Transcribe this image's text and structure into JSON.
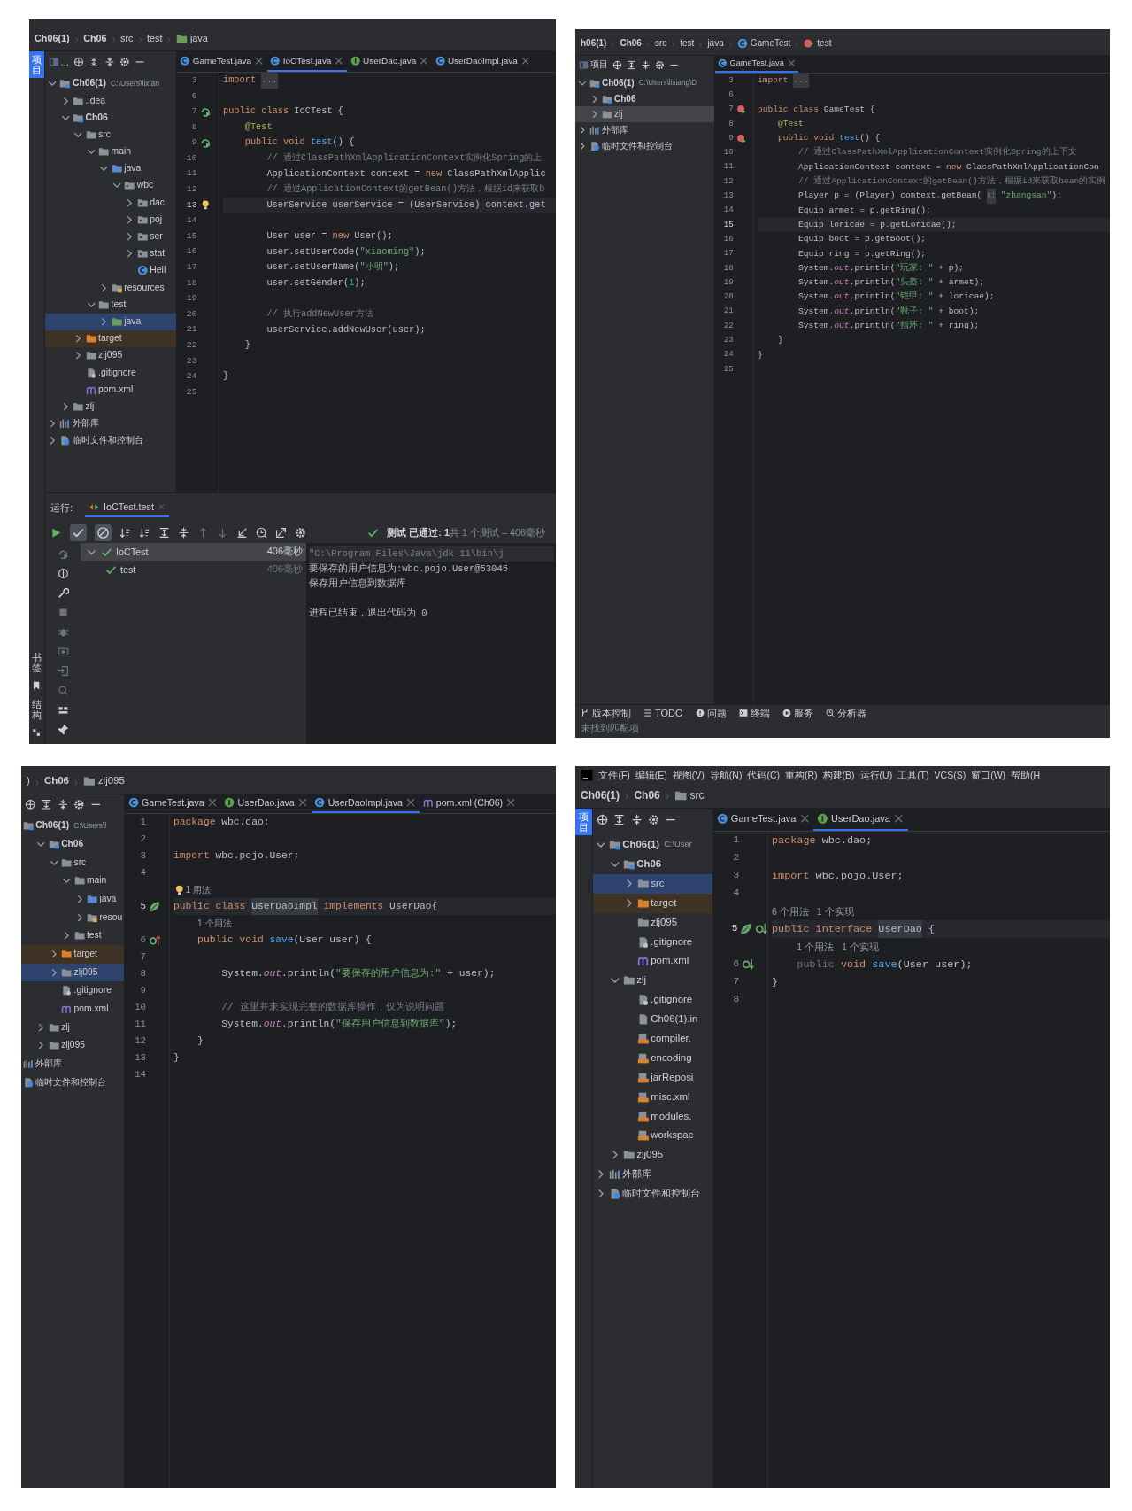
{
  "panels": [
    {
      "breadcrumb": [
        {
          "label": "Ch06(1)",
          "kind": "module"
        },
        {
          "label": "Ch06",
          "kind": "module"
        },
        {
          "label": "src",
          "kind": "plain"
        },
        {
          "label": "test",
          "kind": "plain"
        },
        {
          "label": "java",
          "kind": "test-root"
        }
      ],
      "strip": {
        "top": [
          {
            "label": "项目",
            "selected": true
          }
        ],
        "bottom": [
          {
            "label": "书签",
            "kind": "bookmarks"
          },
          {
            "label": "结构",
            "kind": "structure"
          }
        ]
      },
      "project_pane": {
        "title": "...",
        "focused": true,
        "tree": [
          {
            "label": "Ch06(1)",
            "kind": "module",
            "hint": "C:\\Users\\lixian",
            "expanded": true,
            "selected": false,
            "children": [
              {
                "label": ".idea",
                "kind": "folder",
                "expanded": false,
                "selected": false
              },
              {
                "label": "Ch06",
                "kind": "module",
                "expanded": true,
                "selected": false,
                "children": [
                  {
                    "label": "src",
                    "kind": "folder",
                    "expanded": true,
                    "selected": false,
                    "children": [
                      {
                        "label": "main",
                        "kind": "folder",
                        "expanded": true,
                        "selected": false,
                        "children": [
                          {
                            "label": "java",
                            "kind": "source-root",
                            "expanded": true,
                            "selected": false,
                            "children": [
                              {
                                "label": "wbc",
                                "kind": "package",
                                "expanded": true,
                                "selected": false,
                                "children": [
                                  {
                                    "label": "dac",
                                    "kind": "package",
                                    "expanded": false,
                                    "selected": false
                                  },
                                  {
                                    "label": "poj",
                                    "kind": "package",
                                    "expanded": false,
                                    "selected": false
                                  },
                                  {
                                    "label": "ser",
                                    "kind": "package",
                                    "expanded": false,
                                    "selected": false
                                  },
                                  {
                                    "label": "stat",
                                    "kind": "package",
                                    "expanded": false,
                                    "selected": false
                                  },
                                  {
                                    "label": "Hell",
                                    "kind": "class",
                                    "selected": false
                                  }
                                ]
                              }
                            ]
                          },
                          {
                            "label": "resources",
                            "kind": "resources",
                            "expanded": false,
                            "selected": false
                          }
                        ]
                      },
                      {
                        "label": "test",
                        "kind": "folder",
                        "expanded": true,
                        "selected": false,
                        "children": [
                          {
                            "label": "java",
                            "kind": "test-root",
                            "expanded": false,
                            "selected": true
                          }
                        ]
                      }
                    ]
                  },
                  {
                    "label": "target",
                    "kind": "excluded",
                    "expanded": false,
                    "selected": false
                  },
                  {
                    "label": "zlj095",
                    "kind": "folder",
                    "expanded": false,
                    "selected": false
                  },
                  {
                    "label": ".gitignore",
                    "kind": "git",
                    "selected": false
                  },
                  {
                    "label": "pom.xml",
                    "kind": "maven",
                    "selected": false
                  }
                ]
              },
              {
                "label": "zlj",
                "kind": "folder",
                "expanded": false,
                "selected": false
              }
            ]
          },
          {
            "label": "外部库",
            "kind": "library",
            "expanded": false,
            "selected": false
          },
          {
            "label": "临时文件和控制台",
            "kind": "scratch",
            "expanded": false,
            "selected": false
          }
        ]
      },
      "tabs": [
        {
          "label": "GameTest.java",
          "kind": "class",
          "selected": false
        },
        {
          "label": "IoCTest.java",
          "kind": "class",
          "selected": true
        },
        {
          "label": "UserDao.java",
          "kind": "interface",
          "selected": false
        },
        {
          "label": "UserDaoImpl.java",
          "kind": "class",
          "selected": false
        }
      ],
      "editor": {
        "lines": [
          {
            "kind": "code",
            "num": "3",
            "current": false,
            "tokens": [
              {
                "text": "import ",
                "kind": "kw"
              },
              {
                "text": "...",
                "kind": "fold"
              }
            ]
          },
          {
            "kind": "code",
            "num": "6",
            "current": false
          },
          {
            "kind": "code",
            "num": "7",
            "current": false,
            "markers": [
              {
                "kind": "run-ok"
              }
            ],
            "tokens": [
              {
                "text": "public class ",
                "kind": "kw"
              },
              {
                "text": "IoCTest {"
              }
            ]
          },
          {
            "kind": "code",
            "num": "8",
            "current": false,
            "tokens": [
              {
                "text": "    @Test",
                "kind": "ann"
              }
            ]
          },
          {
            "kind": "code",
            "num": "9",
            "current": false,
            "markers": [
              {
                "kind": "run-ok"
              }
            ],
            "tokens": [
              {
                "text": "    public void ",
                "kind": "kw"
              },
              {
                "text": "test",
                "kind": "fn"
              },
              {
                "text": "() {"
              }
            ]
          },
          {
            "kind": "code",
            "num": "10",
            "current": false,
            "tokens": [
              {
                "text": "        // 通过ClassPathXmlApplicationContext实例化Spring的上",
                "kind": "cmt"
              }
            ]
          },
          {
            "kind": "code",
            "num": "11",
            "current": false,
            "tokens": [
              {
                "text": "        ApplicationContext context = "
              },
              {
                "text": "new ",
                "kind": "kw"
              },
              {
                "text": "ClassPathXmlApplic"
              }
            ]
          },
          {
            "kind": "code",
            "num": "12",
            "current": false,
            "tokens": [
              {
                "text": "        // 通过ApplicationContext的getBean()方法，根据id来获取b",
                "kind": "cmt"
              }
            ]
          },
          {
            "kind": "code",
            "num": "13",
            "current": true,
            "markers": [
              {
                "kind": "bulb"
              }
            ],
            "tokens": [
              {
                "text": "        UserService userService = (UserService) context.get"
              }
            ]
          },
          {
            "kind": "code",
            "num": "14",
            "current": false
          },
          {
            "kind": "code",
            "num": "15",
            "current": false,
            "tokens": [
              {
                "text": "        User user = "
              },
              {
                "text": "new ",
                "kind": "kw"
              },
              {
                "text": "User();"
              }
            ]
          },
          {
            "kind": "code",
            "num": "16",
            "current": false,
            "tokens": [
              {
                "text": "        user.setUserCode("
              },
              {
                "text": "\"xiaoming\"",
                "kind": "str"
              },
              {
                "text": ");"
              }
            ]
          },
          {
            "kind": "code",
            "num": "17",
            "current": false,
            "tokens": [
              {
                "text": "        user.setUserName("
              },
              {
                "text": "\"小明\"",
                "kind": "str"
              },
              {
                "text": ");"
              }
            ]
          },
          {
            "kind": "code",
            "num": "18",
            "current": false,
            "tokens": [
              {
                "text": "        user.setGender("
              },
              {
                "text": "1",
                "kind": "num"
              },
              {
                "text": ");"
              }
            ]
          },
          {
            "kind": "code",
            "num": "19",
            "current": false
          },
          {
            "kind": "code",
            "num": "20",
            "current": false,
            "tokens": [
              {
                "text": "        // 执行addNewUser方法",
                "kind": "cmt"
              }
            ]
          },
          {
            "kind": "code",
            "num": "21",
            "current": false,
            "tokens": [
              {
                "text": "        userService.addNewUser(user);"
              }
            ]
          },
          {
            "kind": "code",
            "num": "22",
            "current": false,
            "tokens": [
              {
                "text": "    }"
              }
            ]
          },
          {
            "kind": "code",
            "num": "23",
            "current": false
          },
          {
            "kind": "code",
            "num": "24",
            "current": false,
            "tokens": [
              {
                "text": "}"
              }
            ]
          },
          {
            "kind": "code",
            "num": "25",
            "current": false
          }
        ]
      },
      "run_panel": {
        "label": "运行:",
        "tabs": [
          {
            "label": "IoCTest.test",
            "selected": true
          }
        ],
        "toggles": [
          {
            "kind": "passed",
            "on": true
          },
          {
            "kind": "ignored",
            "on": true
          }
        ],
        "status": "**测试 已通过: 1**共 1 个测试 – 406毫秒",
        "tests": [
          {
            "name": "IoCTest",
            "time": "406毫秒",
            "passed": true,
            "expanded": true,
            "selected": true,
            "children": [
              {
                "name": "test",
                "time": "406毫秒",
                "passed": true,
                "selected": false
              }
            ]
          }
        ],
        "console": [
          {
            "kind": "command",
            "text": "\"C:\\Program Files\\Java\\jdk-11\\bin\\j"
          },
          {
            "kind": "output",
            "text": "要保存的用户信息为:wbc.pojo.User@53045"
          },
          {
            "kind": "output",
            "text": "保存用户信息到数据库"
          },
          {
            "kind": "exit",
            "text": "进程已结束，退出代码为 0"
          }
        ]
      }
    },
    {
      "breadcrumb": [
        {
          "label": "h06(1)",
          "kind": "module"
        },
        {
          "label": "Ch06",
          "kind": "module"
        },
        {
          "label": "src",
          "kind": "plain"
        },
        {
          "label": "test",
          "kind": "plain"
        },
        {
          "label": "java",
          "kind": "plain"
        },
        {
          "label": "GameTest",
          "kind": "class"
        },
        {
          "label": "test",
          "kind": "method"
        }
      ],
      "project_pane": {
        "title": "项目",
        "focused": false,
        "tree": [
          {
            "label": "Ch06(1)",
            "kind": "module",
            "hint": "C:\\Users\\lixiang\\D",
            "expanded": true,
            "selected": false,
            "children": [
              {
                "label": "Ch06",
                "kind": "module",
                "expanded": false,
                "selected": false
              },
              {
                "label": "zlj",
                "kind": "folder",
                "expanded": false,
                "selected": true
              }
            ]
          },
          {
            "label": "外部库",
            "kind": "library",
            "expanded": false,
            "selected": false
          },
          {
            "label": "临时文件和控制台",
            "kind": "scratch",
            "expanded": false,
            "selected": false
          }
        ]
      },
      "tabs": [
        {
          "label": "GameTest.java",
          "kind": "class",
          "selected": true
        }
      ],
      "editor": {
        "lines": [
          {
            "kind": "code",
            "num": "3",
            "current": false,
            "tokens": [
              {
                "text": "import ",
                "kind": "kw"
              },
              {
                "text": "...",
                "kind": "fold"
              }
            ]
          },
          {
            "kind": "code",
            "num": "6",
            "current": false
          },
          {
            "kind": "code",
            "num": "7",
            "current": false,
            "markers": [
              {
                "kind": "run-fail"
              }
            ],
            "tokens": [
              {
                "text": "public class ",
                "kind": "kw"
              },
              {
                "text": "GameTest {"
              }
            ]
          },
          {
            "kind": "code",
            "num": "8",
            "current": false,
            "tokens": [
              {
                "text": "    @Test",
                "kind": "ann"
              }
            ]
          },
          {
            "kind": "code",
            "num": "9",
            "current": false,
            "markers": [
              {
                "kind": "run-fail"
              }
            ],
            "tokens": [
              {
                "text": "    public void ",
                "kind": "kw"
              },
              {
                "text": "test",
                "kind": "fn"
              },
              {
                "text": "() {"
              }
            ]
          },
          {
            "kind": "code",
            "num": "10",
            "current": false,
            "tokens": [
              {
                "text": "        // 通过ClassPathXmlApplicationContext实例化Spring的上下文",
                "kind": "cmt"
              }
            ]
          },
          {
            "kind": "code",
            "num": "11",
            "current": false,
            "tokens": [
              {
                "text": "        ApplicationContext context = "
              },
              {
                "text": "new ",
                "kind": "kw"
              },
              {
                "text": "ClassPathXmlApplicationCon"
              }
            ]
          },
          {
            "kind": "code",
            "num": "12",
            "current": false,
            "tokens": [
              {
                "text": "        // 通过ApplicationContext的getBean()方法，根据id来获取bean的实例",
                "kind": "cmt"
              }
            ]
          },
          {
            "kind": "code",
            "num": "13",
            "current": false,
            "tokens": [
              {
                "text": "        Player p = (Player) context.getBean( "
              },
              {
                "text": "s:",
                "kind": "param"
              },
              {
                "text": " \"zhangsan\"",
                "kind": "str"
              },
              {
                "text": ");"
              }
            ]
          },
          {
            "kind": "code",
            "num": "14",
            "current": false,
            "tokens": [
              {
                "text": "        Equip armet = p.getRing();"
              }
            ]
          },
          {
            "kind": "code",
            "num": "15",
            "current": true,
            "tokens": [
              {
                "text": "        Equip loricae = p.getLoricae();"
              }
            ]
          },
          {
            "kind": "code",
            "num": "16",
            "current": false,
            "tokens": [
              {
                "text": "        Equip boot = p.getBoot();"
              }
            ]
          },
          {
            "kind": "code",
            "num": "17",
            "current": false,
            "tokens": [
              {
                "text": "        Equip ring = p.getRing();"
              }
            ]
          },
          {
            "kind": "code",
            "num": "18",
            "current": false,
            "tokens": [
              {
                "text": "        System."
              },
              {
                "text": "out",
                "kind": "fld"
              },
              {
                "text": ".println("
              },
              {
                "text": "\"玩家: \"",
                "kind": "str"
              },
              {
                "text": " + p);"
              }
            ]
          },
          {
            "kind": "code",
            "num": "19",
            "current": false,
            "tokens": [
              {
                "text": "        System."
              },
              {
                "text": "out",
                "kind": "fld"
              },
              {
                "text": ".println("
              },
              {
                "text": "\"头盔: \"",
                "kind": "str"
              },
              {
                "text": " + armet);"
              }
            ]
          },
          {
            "kind": "code",
            "num": "20",
            "current": false,
            "tokens": [
              {
                "text": "        System."
              },
              {
                "text": "out",
                "kind": "fld"
              },
              {
                "text": ".println("
              },
              {
                "text": "\"铠甲: \"",
                "kind": "str"
              },
              {
                "text": " + loricae);"
              }
            ]
          },
          {
            "kind": "code",
            "num": "21",
            "current": false,
            "tokens": [
              {
                "text": "        System."
              },
              {
                "text": "out",
                "kind": "fld"
              },
              {
                "text": ".println("
              },
              {
                "text": "\"靴子: \"",
                "kind": "str"
              },
              {
                "text": " + boot);"
              }
            ]
          },
          {
            "kind": "code",
            "num": "22",
            "current": false,
            "tokens": [
              {
                "text": "        System."
              },
              {
                "text": "out",
                "kind": "fld"
              },
              {
                "text": ".println("
              },
              {
                "text": "\"指环: \"",
                "kind": "str"
              },
              {
                "text": " + ring);"
              }
            ]
          },
          {
            "kind": "code",
            "num": "23",
            "current": false,
            "tokens": [
              {
                "text": "    }"
              }
            ]
          },
          {
            "kind": "code",
            "num": "24",
            "current": false,
            "tokens": [
              {
                "text": "}"
              }
            ]
          },
          {
            "kind": "code",
            "num": "25",
            "current": false
          }
        ]
      },
      "status_bar": {
        "tools": [
          {
            "kind": "vcs",
            "label": "版本控制"
          },
          {
            "kind": "todo",
            "label": "TODO"
          },
          {
            "kind": "problems",
            "label": "问题"
          },
          {
            "kind": "terminal",
            "label": "终端"
          },
          {
            "kind": "services",
            "label": "服务"
          },
          {
            "kind": "profiler",
            "label": "分析器"
          }
        ],
        "message": "未找到匹配项"
      }
    },
    {
      "breadcrumb": [
        {
          "label": ")",
          "kind": "plain"
        },
        {
          "label": "Ch06",
          "kind": "module"
        },
        {
          "label": "zlj095",
          "kind": "folder"
        }
      ],
      "project_pane": {
        "focused": true,
        "tree": [
          {
            "label": "Ch06(1)",
            "kind": "module",
            "hint": "C:\\Users\\l",
            "selected": false,
            "children": [
              {
                "label": "Ch06",
                "kind": "module",
                "expanded": true,
                "selected": false,
                "children": [
                  {
                    "label": "src",
                    "kind": "folder",
                    "expanded": true,
                    "selected": false,
                    "children": [
                      {
                        "label": "main",
                        "kind": "folder",
                        "expanded": true,
                        "selected": false,
                        "children": [
                          {
                            "label": "java",
                            "kind": "source-root",
                            "expanded": false,
                            "selected": false
                          },
                          {
                            "label": "resou",
                            "kind": "resources",
                            "expanded": false,
                            "selected": false
                          }
                        ]
                      },
                      {
                        "label": "test",
                        "kind": "folder",
                        "expanded": false,
                        "selected": false
                      }
                    ]
                  },
                  {
                    "label": "target",
                    "kind": "excluded",
                    "expanded": false,
                    "selected": false
                  },
                  {
                    "label": "zlj095",
                    "kind": "folder",
                    "expanded": false,
                    "selected": true
                  },
                  {
                    "label": ".gitignore",
                    "kind": "git",
                    "selected": false
                  },
                  {
                    "label": "pom.xml",
                    "kind": "maven",
                    "selected": false
                  }
                ]
              },
              {
                "label": "zlj",
                "kind": "folder",
                "expanded": false,
                "selected": false
              },
              {
                "label": "zlj095",
                "kind": "folder",
                "expanded": false,
                "selected": false
              }
            ]
          },
          {
            "label": "外部库",
            "kind": "library",
            "selected": false
          },
          {
            "label": "临时文件和控制台",
            "kind": "scratch",
            "selected": false
          }
        ]
      },
      "tabs": [
        {
          "label": "GameTest.java",
          "kind": "class",
          "selected": false
        },
        {
          "label": "UserDao.java",
          "kind": "interface",
          "selected": false
        },
        {
          "label": "UserDaoImpl.java",
          "kind": "class",
          "selected": true
        },
        {
          "label": "pom.xml (Ch06)",
          "kind": "maven",
          "selected": false
        }
      ],
      "editor": {
        "lines": [
          {
            "kind": "code",
            "num": "1",
            "current": false,
            "tokens": [
              {
                "text": "package ",
                "kind": "kw"
              },
              {
                "text": "wbc.dao;"
              }
            ]
          },
          {
            "kind": "code",
            "num": "2",
            "current": false
          },
          {
            "kind": "code",
            "num": "3",
            "current": false,
            "tokens": [
              {
                "text": "import ",
                "kind": "kw"
              },
              {
                "text": "wbc.pojo.User;"
              }
            ]
          },
          {
            "kind": "code",
            "num": "4",
            "current": false
          },
          {
            "kind": "hint",
            "text": "1 用法",
            "bulb": true,
            "current": false
          },
          {
            "kind": "code",
            "num": "5",
            "current": true,
            "markers": [
              {
                "kind": "bean"
              }
            ],
            "tokens": [
              {
                "text": "public class ",
                "kind": "kw"
              },
              {
                "text": "UserDaoImpl",
                "kind": "hl"
              },
              {
                "text": " implements ",
                "kind": "kw"
              },
              {
                "text": "UserDao{"
              }
            ]
          },
          {
            "kind": "hint",
            "text": "1 个用法",
            "current": false
          },
          {
            "kind": "code",
            "num": "6",
            "current": false,
            "markers": [
              {
                "kind": "impl-up"
              }
            ],
            "tokens": [
              {
                "text": "    public void ",
                "kind": "kw"
              },
              {
                "text": "save",
                "kind": "fn"
              },
              {
                "text": "(User user) {"
              }
            ]
          },
          {
            "kind": "code",
            "num": "7",
            "current": false
          },
          {
            "kind": "code",
            "num": "8",
            "current": false,
            "tokens": [
              {
                "text": "        System."
              },
              {
                "text": "out",
                "kind": "fld"
              },
              {
                "text": ".println("
              },
              {
                "text": "\"要保存的用户信息为:\"",
                "kind": "str"
              },
              {
                "text": " + user);"
              }
            ]
          },
          {
            "kind": "code",
            "num": "9",
            "current": false
          },
          {
            "kind": "code",
            "num": "10",
            "current": false,
            "tokens": [
              {
                "text": "        // 这里并未实现完整的数据库操作，仅为说明问题",
                "kind": "cmt"
              }
            ]
          },
          {
            "kind": "code",
            "num": "11",
            "current": false,
            "tokens": [
              {
                "text": "        System."
              },
              {
                "text": "out",
                "kind": "fld"
              },
              {
                "text": ".println("
              },
              {
                "text": "\"保存用户信息到数据库\"",
                "kind": "str"
              },
              {
                "text": ");"
              }
            ]
          },
          {
            "kind": "code",
            "num": "12",
            "current": false,
            "tokens": [
              {
                "text": "    }"
              }
            ]
          },
          {
            "kind": "code",
            "num": "13",
            "current": false,
            "tokens": [
              {
                "text": "}"
              }
            ]
          },
          {
            "kind": "code",
            "num": "14",
            "current": false
          }
        ]
      }
    },
    {
      "menu": [
        "文件(F)",
        "编辑(E)",
        "视图(V)",
        "导航(N)",
        "代码(C)",
        "重构(R)",
        "构建(B)",
        "运行(U)",
        "工具(T)",
        "VCS(S)",
        "窗口(W)",
        "帮助(H"
      ],
      "breadcrumb": [
        {
          "label": "Ch06(1)",
          "kind": "module"
        },
        {
          "label": "Ch06",
          "kind": "module"
        },
        {
          "label": "src",
          "kind": "folder"
        }
      ],
      "strip": {
        "top": [
          {
            "label": "项目",
            "selected": true
          }
        ]
      },
      "project_pane": {
        "focused": true,
        "tree": [
          {
            "label": "Ch06(1)",
            "kind": "module",
            "hint": "C:\\User",
            "expanded": true,
            "selected": false,
            "children": [
              {
                "label": "Ch06",
                "kind": "module",
                "expanded": true,
                "selected": false,
                "children": [
                  {
                    "label": "src",
                    "kind": "folder",
                    "expanded": false,
                    "selected": true
                  },
                  {
                    "label": "target",
                    "kind": "excluded",
                    "expanded": false,
                    "selected": false
                  },
                  {
                    "label": "zlj095",
                    "kind": "folder",
                    "selected": false
                  },
                  {
                    "label": ".gitignore",
                    "kind": "git",
                    "selected": false
                  },
                  {
                    "label": "pom.xml",
                    "kind": "maven",
                    "selected": false
                  }
                ]
              },
              {
                "label": "zlj",
                "kind": "folder",
                "expanded": true,
                "selected": false,
                "children": [
                  {
                    "label": ".gitignore",
                    "kind": "git",
                    "selected": false
                  },
                  {
                    "label": "Ch06(1).in",
                    "kind": "iml",
                    "selected": false
                  },
                  {
                    "label": "compiler.",
                    "kind": "xml-config",
                    "selected": false
                  },
                  {
                    "label": "encoding",
                    "kind": "xml-config",
                    "selected": false
                  },
                  {
                    "label": "jarReposi",
                    "kind": "xml-config",
                    "selected": false
                  },
                  {
                    "label": "misc.xml",
                    "kind": "xml-config",
                    "selected": false
                  },
                  {
                    "label": "modules.",
                    "kind": "xml-config",
                    "selected": false
                  },
                  {
                    "label": "workspac",
                    "kind": "xml-config",
                    "selected": false
                  }
                ]
              },
              {
                "label": "zlj095",
                "kind": "folder",
                "expanded": false,
                "selected": false
              }
            ]
          },
          {
            "label": "外部库",
            "kind": "library",
            "expanded": false,
            "selected": false
          },
          {
            "label": "临时文件和控制台",
            "kind": "scratch",
            "expanded": false,
            "selected": false
          }
        ]
      },
      "tabs": [
        {
          "label": "GameTest.java",
          "kind": "class",
          "selected": false
        },
        {
          "label": "UserDao.java",
          "kind": "interface",
          "selected": true
        }
      ],
      "editor": {
        "lines": [
          {
            "kind": "code",
            "num": "1",
            "current": false,
            "tokens": [
              {
                "text": "package ",
                "kind": "kw"
              },
              {
                "text": "wbc.dao;"
              }
            ]
          },
          {
            "kind": "code",
            "num": "2",
            "current": false
          },
          {
            "kind": "code",
            "num": "3",
            "current": false,
            "tokens": [
              {
                "text": "import ",
                "kind": "kw"
              },
              {
                "text": "wbc.pojo.User;"
              }
            ]
          },
          {
            "kind": "code",
            "num": "4",
            "current": false
          },
          {
            "kind": "hint",
            "text": "6 个用法   1 个实现",
            "current": false
          },
          {
            "kind": "code",
            "num": "5",
            "current": true,
            "markers": [
              {
                "kind": "bean"
              },
              {
                "kind": "impl-down"
              }
            ],
            "tokens": [
              {
                "text": "public interface ",
                "kind": "kw"
              },
              {
                "text": "UserDao",
                "kind": "hl"
              },
              {
                "text": " {"
              }
            ]
          },
          {
            "kind": "hint",
            "text": "1 个用法   1 个实现",
            "current": false
          },
          {
            "kind": "code",
            "num": "6",
            "current": false,
            "markers": [
              {
                "kind": "impl-down"
              }
            ],
            "tokens": [
              {
                "text": "    public ",
                "kind": "dim"
              },
              {
                "text": "void ",
                "kind": "kw"
              },
              {
                "text": "save",
                "kind": "fn"
              },
              {
                "text": "(User user);"
              }
            ]
          },
          {
            "kind": "code",
            "num": "7",
            "current": false,
            "tokens": [
              {
                "text": "}"
              }
            ]
          },
          {
            "kind": "code",
            "num": "8",
            "current": false
          }
        ]
      }
    }
  ]
}
